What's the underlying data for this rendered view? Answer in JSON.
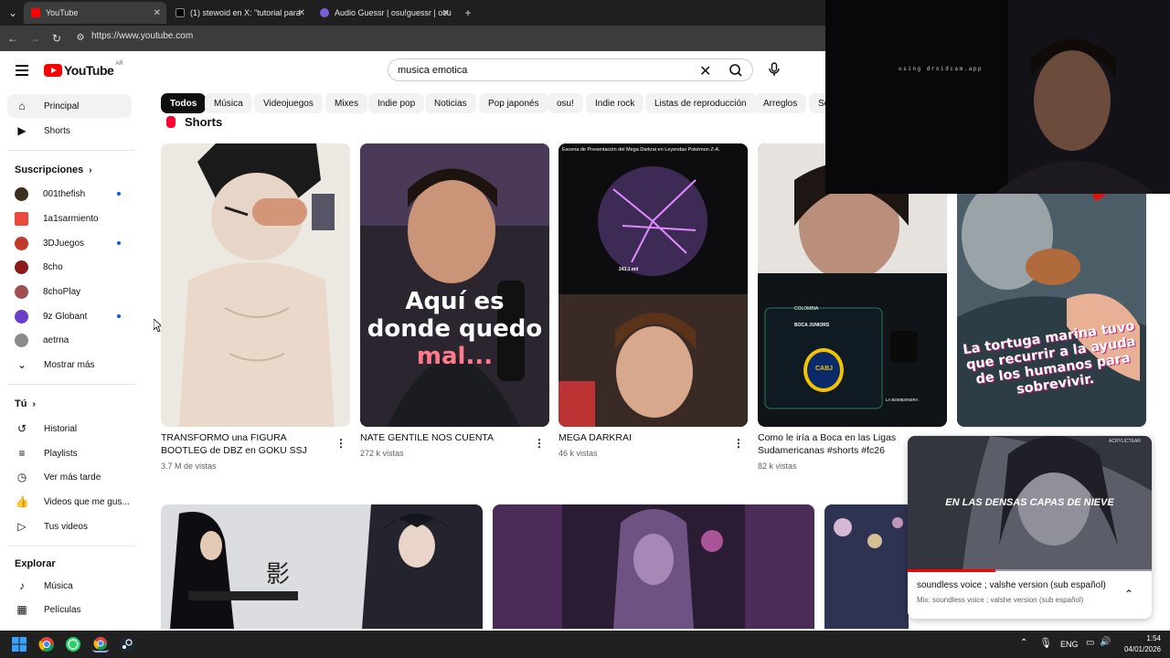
{
  "browser": {
    "tabs": [
      {
        "title": "YouTube"
      },
      {
        "title": "(1) stewoid en X: \"tutorial para"
      },
      {
        "title": "Audio Guessr | osu!guessr | osu"
      }
    ],
    "url": "https://www.youtube.com"
  },
  "header": {
    "logo_text": "YouTube",
    "country_code": "AR",
    "search_value": "musica emotica"
  },
  "sidebar": {
    "main": [
      {
        "label": "Principal"
      },
      {
        "label": "Shorts"
      }
    ],
    "subscriptions_title": "Suscripciones",
    "subscriptions": [
      {
        "label": "001thefish",
        "color": "#3c2f1e",
        "new": true
      },
      {
        "label": "1a1sarmiento",
        "color": "#e74c3c",
        "new": false
      },
      {
        "label": "3DJuegos",
        "color": "#c0392b",
        "new": true
      },
      {
        "label": "8cho",
        "color": "#8b1a1a",
        "new": false
      },
      {
        "label": "8choPlay",
        "color": "#a05050",
        "new": false
      },
      {
        "label": "9z Globant",
        "color": "#6a3ec9",
        "new": true
      },
      {
        "label": "aetrna",
        "color": "#8a8a8a",
        "new": false
      }
    ],
    "show_more": "Mostrar más",
    "you_title": "Tú",
    "you_items": [
      {
        "label": "Historial"
      },
      {
        "label": "Playlists"
      },
      {
        "label": "Ver más tarde"
      },
      {
        "label": "Videos que me gus..."
      },
      {
        "label": "Tus videos"
      }
    ],
    "explore_title": "Explorar",
    "explore_items": [
      {
        "label": "Música"
      },
      {
        "label": "Películas"
      }
    ]
  },
  "chips": [
    "Todos",
    "Música",
    "Videojuegos",
    "Mixes",
    "Indie pop",
    "Noticias",
    "Pop japonés",
    "osu!",
    "Indie rock",
    "Listas de reproducción",
    "Arreglos",
    "So"
  ],
  "shorts_title": "Shorts",
  "shorts": [
    {
      "title": "TRANSFORMO una FIGURA BOOTLEG de DBZ en GOKU SSJ #custom #figu...",
      "views": "3.7 M de vistas"
    },
    {
      "title": "NATE GENTILE NOS CUENTA TODO!!!",
      "views": "272 k vistas",
      "overlay_line1": "Aquí es",
      "overlay_line2": "donde quedo",
      "overlay_line3": "mal..."
    },
    {
      "title": "MEGA DARKRAI",
      "views": "46 k vistas",
      "overlay_top": "Escena de Presentación del Mega Darkrai en Leyendas Pokémon Z-A.",
      "overlay_stats": "243,1 mil"
    },
    {
      "title": "Como le iría a Boca en las Ligas Sudamericanas #shorts #fc26",
      "views": "82 k vistas",
      "overlay_club": "BOCA JUNIORS",
      "overlay_country": "COLOMBIA",
      "overlay_badge": "CABJ",
      "overlay_stadium": "LA BOMBONERA"
    },
    {
      "title": "",
      "views": "",
      "overlay_caption": "La tortuga marina tuvo que recurrir a la ayuda de los humanos para sobrevivir."
    }
  ],
  "webcam": {
    "caption": "using droidcam.app"
  },
  "miniplayer": {
    "video_caption": "EN LAS DENSAS CAPAS DE NIEVE",
    "watermark": "ACRYLICTEAR",
    "title": "soundless voice ; valshe version (sub español)",
    "subtitle": "Mix: soundless voice ; valshe version (sub español)",
    "progress_fraction": 0.36
  },
  "taskbar": {
    "language": "ENG",
    "time": "1:54",
    "date": "04/01/2026"
  }
}
